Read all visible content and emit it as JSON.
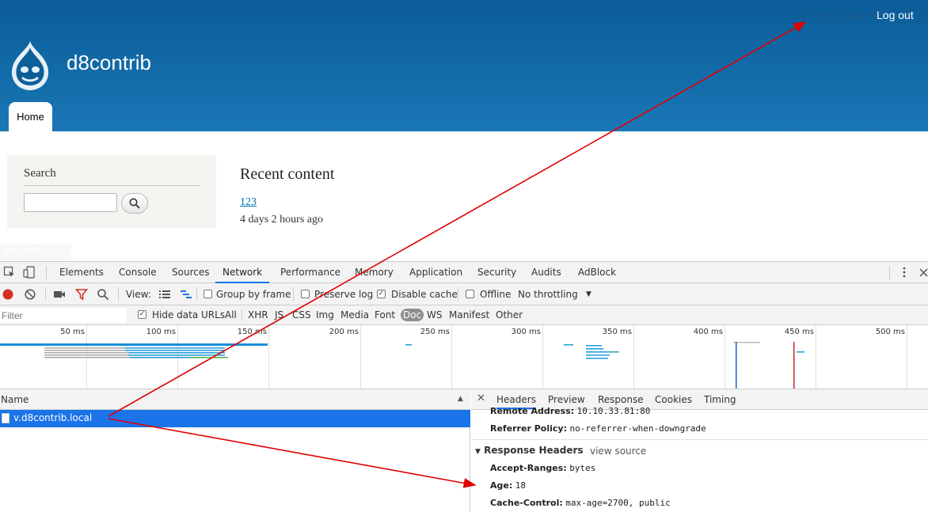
{
  "site": {
    "name": "d8contrib",
    "user_greeting": "Hi, Fancy User",
    "logout_label": "Log out",
    "nav_home": "Home",
    "search_title": "Search",
    "recent_title": "Recent content",
    "recent_item": "123",
    "recent_time": "4 days 2 hours ago",
    "hover_tip": "d8contrib.local",
    "header_color": "#1a77b6"
  },
  "devtools": {
    "tabs": [
      "Elements",
      "Console",
      "Sources",
      "Network",
      "Performance",
      "Memory",
      "Application",
      "Security",
      "Audits",
      "AdBlock"
    ],
    "active_tab": "Network",
    "toolbar": {
      "view_label": "View:",
      "group_by_frame": "Group by frame",
      "preserve_log": "Preserve log",
      "disable_cache": "Disable cache",
      "offline": "Offline",
      "throttling": "No throttling"
    },
    "filter": {
      "placeholder": "Filter",
      "hide_data_urls": "Hide data URLs",
      "types": [
        "All",
        "XHR",
        "JS",
        "CSS",
        "Img",
        "Media",
        "Font",
        "Doc",
        "WS",
        "Manifest",
        "Other"
      ],
      "selected_type": "Doc"
    },
    "timeline_ticks": [
      "50 ms",
      "100 ms",
      "150 ms",
      "200 ms",
      "250 ms",
      "300 ms",
      "350 ms",
      "400 ms",
      "450 ms",
      "500 ms"
    ],
    "requests": {
      "column_name": "Name",
      "rows": [
        "v.d8contrib.local"
      ]
    },
    "details": {
      "tabs": [
        "Headers",
        "Preview",
        "Response",
        "Cookies",
        "Timing"
      ],
      "active_tab": "Headers",
      "remote_address_label": "Remote Address:",
      "remote_address_value": "10.10.33.81:80",
      "referrer_label": "Referrer Policy:",
      "referrer_value": "no-referrer-when-downgrade",
      "response_headers_label": "Response Headers",
      "view_source": "view source",
      "headers": [
        {
          "name": "Accept-Ranges:",
          "value": "bytes"
        },
        {
          "name": "Age:",
          "value": "18"
        },
        {
          "name": "Cache-Control:",
          "value": "max-age=2700, public"
        }
      ]
    },
    "accent_color": "#1a73e8",
    "annotation_color": "#e00000"
  }
}
